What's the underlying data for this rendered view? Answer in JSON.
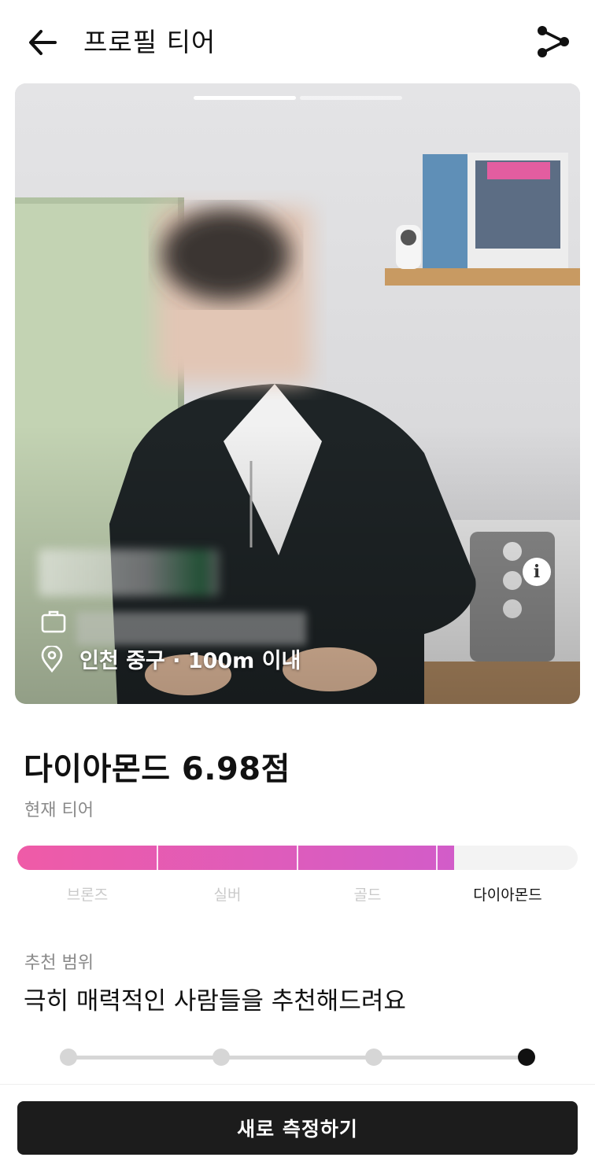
{
  "header": {
    "title": "프로필 티어",
    "back_icon": "arrow-left-icon",
    "share_icon": "share-icon"
  },
  "photo": {
    "story_pages": 2,
    "story_active": 1,
    "location": "인천 중구 · 100m 이내",
    "job_icon": "briefcase-icon",
    "location_icon": "map-pin-icon",
    "info_icon": "info-icon",
    "info_glyph": "i"
  },
  "tier": {
    "score_title": "다이아몬드 6.98점",
    "current_label": "현재 티어",
    "levels": [
      "브론즈",
      "실버",
      "골드",
      "다이아몬드"
    ],
    "current_level": "다이아몬드",
    "progress_fraction": 0.78,
    "accent_start": "#ef5ba7",
    "accent_end": "#d25cc9"
  },
  "recommendation": {
    "label": "추천 범위",
    "description": "극히 매력적인 사람들을 추천해드려요",
    "slider_steps": 4,
    "slider_selected_index": 3
  },
  "cta": {
    "label": "새로 측정하기"
  }
}
